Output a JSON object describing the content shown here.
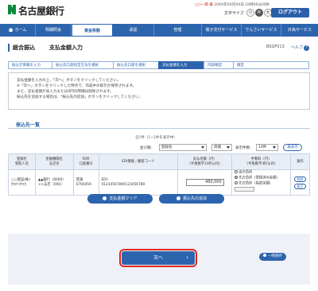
{
  "header": {
    "bank_name": "名古屋銀行",
    "user_line": "○○一郎 様",
    "last_login": "20XX年XX月XX日 10時00分00秒",
    "font_size_label": "文字サイズ",
    "size_small": "小",
    "size_medium": "中",
    "size_large": "大",
    "logout_label": "ログアウト"
  },
  "nav": {
    "items": [
      {
        "label": "ホーム"
      },
      {
        "label": "明細照会"
      },
      {
        "label": "資金移動"
      },
      {
        "label": "承認"
      },
      {
        "label": "管理"
      },
      {
        "label": "電子交付サービス"
      },
      {
        "label": "でんさいサービス"
      },
      {
        "label": "外為サービス"
      }
    ]
  },
  "page": {
    "title_main": "総合振込",
    "title_sub": "支払金額入力",
    "screen_id": "BSGF013",
    "help_label": "ヘルプ",
    "help_icon": "?"
  },
  "steps": [
    {
      "label": "振込元情報を入力"
    },
    {
      "label": "振込先口座指定方法を選択"
    },
    {
      "label": "振込先口座を選択"
    },
    {
      "label": "支払金額を入力"
    },
    {
      "label": "内容確認"
    },
    {
      "label": "確定"
    }
  ],
  "instructions": [
    "支払金額を入力の上、「次へ」ボタンをクリックしてください。",
    "※「次へ」ボタンをクリックした時点で、作成中の取引が保存されます。",
    "また、支払金額が未入力または0円の明細は削除されます。",
    "振込先を追加する場合は、「振込先の追加」ボタンをクリックしてください。"
  ],
  "section": {
    "title": "振込先一覧",
    "count_text": "全1件（1~1件を表示中）",
    "sort_label": "並び順：",
    "sort_value": "登録名",
    "order_value": "昇順",
    "per_page_label": "表示件数：",
    "per_page_value": "10件",
    "redisplay_label": "再表示"
  },
  "table": {
    "headers": {
      "reg_name": "登録名\n受取人名",
      "bank": "金融機関名\n支店名",
      "account": "科目\n口座番号",
      "edi": "EDI情報／顧客コード",
      "amount": "支払金額（円）\n（半角数字10桁以内）",
      "fee": "手数料（円）\n（半角数字4桁以内）",
      "op": "操作"
    },
    "row": {
      "reg_name": "○○建設(株)",
      "recipient": "ｶﾏﾙｹﾝｾﾂ(ｶ",
      "bank_name": "▲▲銀行（0000）",
      "branch_name": "××支店（000）",
      "subject": "普通",
      "account_no": "0760459",
      "edi_label": "EDI：",
      "edi_code": "01234567890123456789",
      "amount": "480,000",
      "fee_opt1": "当方負担",
      "fee_opt2": "先方負担（登録済み金額）",
      "fee_opt3": "先方負担（指定金額）",
      "btn_delete": "削除",
      "btn_modify": "修正"
    }
  },
  "actions": {
    "clear_label": "支払金額クリア",
    "add_label": "振込先の追加",
    "next_label": "次へ",
    "next_arrow": "›",
    "save_label": "一時保存"
  },
  "colors": {
    "brand_blue": "#2d64ae",
    "highlight_red": "#e2261e"
  }
}
